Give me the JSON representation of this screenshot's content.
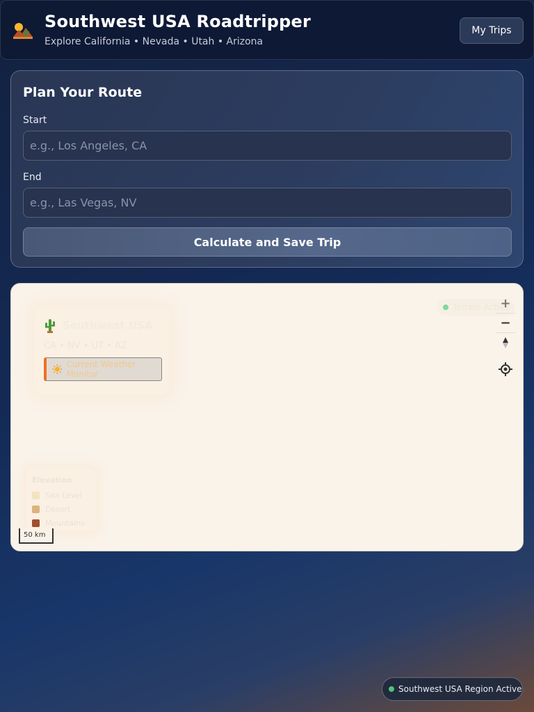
{
  "header": {
    "title": "Southwest USA Roadtripper",
    "subtitle": "Explore California • Nevada • Utah • Arizona",
    "my_trips_label": "My Trips",
    "logo_icon": "desert-sunset-icon"
  },
  "plan": {
    "title": "Plan Your Route",
    "start_label": "Start",
    "start_value": "",
    "start_placeholder": "e.g., Los Angeles, CA",
    "end_label": "End",
    "end_value": "",
    "end_placeholder": "e.g., Las Vegas, NV",
    "submit_label": "Calculate and Save Trip"
  },
  "map": {
    "info_card": {
      "title": "Southwest USA",
      "states": "CA • NV • UT • AZ",
      "weather_label": "Current Weather Monitor"
    },
    "terrain_status": "Terrain Active",
    "controls": {
      "zoom_in": "+",
      "zoom_out": "−",
      "compass": "▲"
    },
    "legend": {
      "title": "Elevation",
      "items": [
        {
          "label": "Sea Level",
          "color": "#f3e3c0"
        },
        {
          "label": "Desert",
          "color": "#dcb47e"
        },
        {
          "label": "Mountains",
          "color": "#a14e2c"
        }
      ]
    },
    "scale_label": "50 km"
  },
  "status": {
    "region_active": "Southwest USA Region Active",
    "accent_color": "#4ec27a"
  }
}
